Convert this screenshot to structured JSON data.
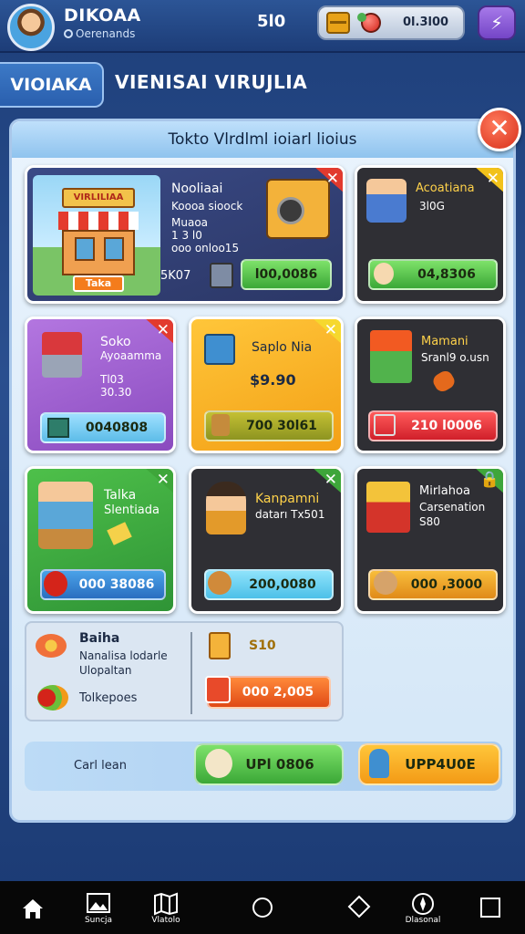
{
  "header": {
    "player_name": "DIKOAA",
    "player_sub": "Oerenands",
    "score": "5l0",
    "currency_value": "0l.3l00",
    "menu_icon": "bolt-icon"
  },
  "tabs": {
    "active_label": "VIOIAKA",
    "title": "VIENISAI VIRUJLIA"
  },
  "panel": {
    "title": "Tokto Vlrdlml ioiarl lioius"
  },
  "cards": {
    "shop": {
      "sign": "VIRLILIAA",
      "name": "Nooliaai",
      "line1": "Koooa sioock",
      "line2": "Muaoa",
      "line3": "1 3 l0",
      "line4": "ooo onloo15",
      "badge": "Taka",
      "price_label": "5K07",
      "price": "l00,0086",
      "accent": "#4fc24a"
    },
    "top_right": {
      "name": "Acoatiana",
      "line1": "3l0G",
      "price": "04,8306",
      "accent": "#4fc24a"
    },
    "purple": {
      "name": "Soko",
      "line1": "Ayoaamma",
      "line2": "Tl03",
      "line3": "30.30",
      "price": "0040808",
      "accent": "#9a57c7"
    },
    "orange": {
      "name": "Saplo Nia",
      "price_big": "$9.90",
      "price": "700 30l61",
      "accent": "#f9b21c"
    },
    "dark_red": {
      "name": "Mamani",
      "line1": "Sranl9 o.usn",
      "price": "210 l0006",
      "accent": "#e6313a"
    },
    "green": {
      "name": "Talka",
      "line1": "Slentiada",
      "price": "000 38086",
      "accent": "#3fae3a"
    },
    "dark_mid": {
      "name": "Kanpamni",
      "line1": "datarı Tx501",
      "price": "200,0080",
      "accent": "#5cc5ea"
    },
    "dark_right": {
      "name": "Mirlahoa",
      "line1": "Carsenation",
      "line2": "S80",
      "price": "000 ,3000",
      "accent": "#f3a62a"
    }
  },
  "info": {
    "title": "Baiha",
    "line1": "Nanalisa lodarle",
    "line2": "Ulopaltan",
    "line3": "Tolkepoes",
    "side_value": "S10",
    "price": "000 2,005"
  },
  "cta": {
    "label": "Carl lean",
    "btn1": "UPl 0806",
    "btn2": "UPP4U0E"
  },
  "nav": [
    {
      "icon": "home-icon",
      "label": ""
    },
    {
      "icon": "image-icon",
      "label": "Suncja"
    },
    {
      "icon": "map-icon",
      "label": "Vlatolo"
    },
    {
      "icon": "circle-icon",
      "label": ""
    },
    {
      "icon": "tag-icon",
      "label": ""
    },
    {
      "icon": "compass-icon",
      "label": "Dlasonal"
    },
    {
      "icon": "square-icon",
      "label": ""
    }
  ]
}
